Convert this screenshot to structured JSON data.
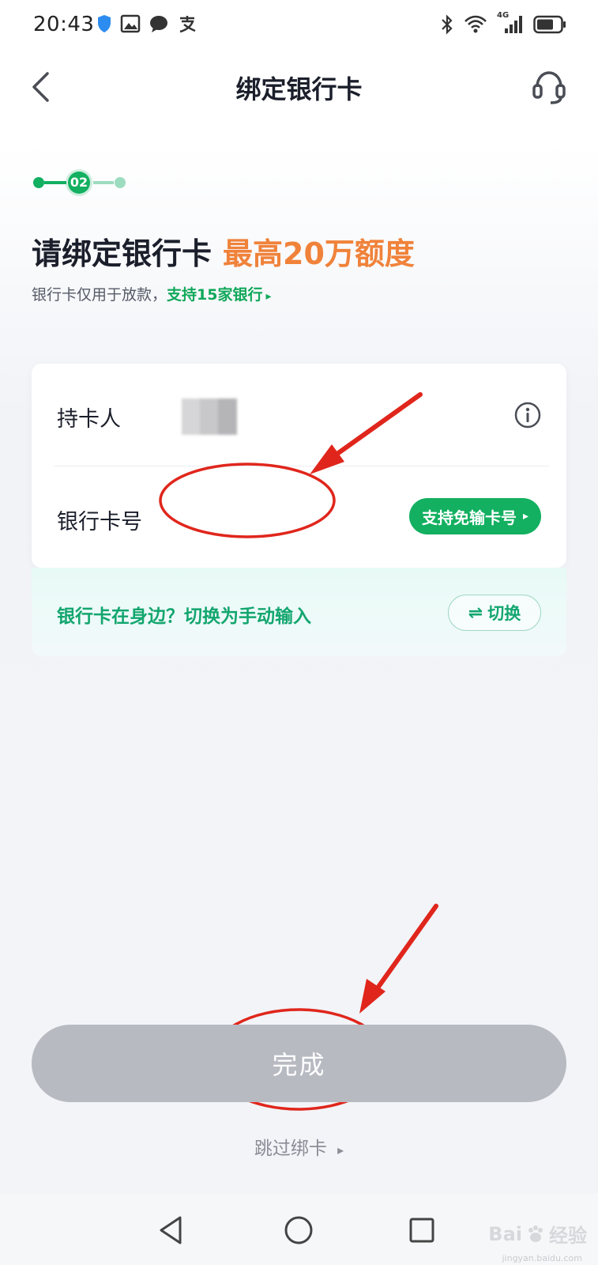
{
  "status_bar": {
    "time": "20:43",
    "network_label": "4G",
    "left_icons": [
      "shield-icon",
      "gallery-icon",
      "chat-icon",
      "alipay-icon"
    ],
    "right_icons": [
      "bluetooth-icon",
      "wifi-icon",
      "signal-icon",
      "battery-icon"
    ]
  },
  "header": {
    "title": "绑定银行卡",
    "back_icon": "chevron-left-icon",
    "service_icon": "headset-icon"
  },
  "steps": {
    "current": "02",
    "total": 3
  },
  "headline": {
    "main": "请绑定银行卡",
    "accent": "最高20万额度"
  },
  "subline": {
    "text": "银行卡仅用于放款，",
    "link": "支持15家银行",
    "link_arrow": "▸"
  },
  "form": {
    "holder_label": "持卡人",
    "card_label": "银行卡号",
    "card_value": "",
    "scan_button": "支持免输卡号",
    "scan_arrow": "▸"
  },
  "manual": {
    "text": "银行卡在身边？切换为手动输入",
    "switch_icon": "⇌",
    "switch_label": "切换"
  },
  "actions": {
    "done": "完成",
    "skip": "跳过绑卡",
    "skip_arrow": "▸"
  },
  "system_nav": {
    "icons": [
      "back-triangle-icon",
      "home-circle-icon",
      "recents-square-icon"
    ]
  },
  "watermark": {
    "brand": "Bai",
    "brand_cn": "经验",
    "site": "jingyan.baidu.com"
  },
  "colors": {
    "accent_green": "#12b060",
    "accent_orange": "#f0823a",
    "annotation_red": "#e0261c",
    "button_disabled": "#b8bac2"
  }
}
